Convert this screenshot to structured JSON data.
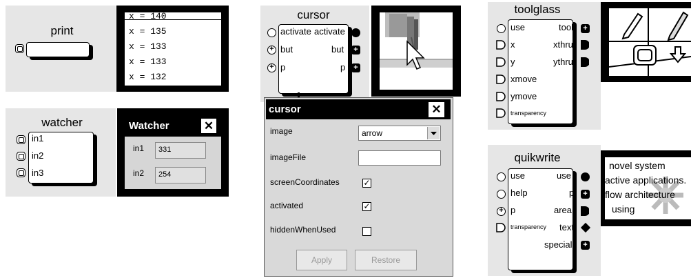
{
  "print": {
    "title": "print",
    "log_lines": [
      "x = 140",
      "x = 135",
      "x = 133",
      "x = 133",
      "x = 132"
    ]
  },
  "watcher": {
    "title": "watcher",
    "inputs": [
      "in1",
      "in2",
      "in3"
    ],
    "window": {
      "title": "Watcher",
      "close": "✕",
      "rows": [
        {
          "label": "in1",
          "value": "331"
        },
        {
          "label": "in2",
          "value": "254"
        }
      ]
    }
  },
  "cursor": {
    "title": "cursor",
    "ports": [
      {
        "in": "activate",
        "out": "activate"
      },
      {
        "in": "but",
        "out": "but"
      },
      {
        "in": "p",
        "out": "p"
      }
    ],
    "dialog": {
      "title": "cursor",
      "close": "✕",
      "image_label": "image",
      "image_value": "arrow",
      "imagefile_label": "imageFile",
      "imagefile_value": "",
      "checks": [
        {
          "label": "screenCoordinates",
          "checked": true,
          "mark": "✓"
        },
        {
          "label": "activated",
          "checked": true,
          "mark": "✓"
        },
        {
          "label": "hiddenWhenUsed",
          "checked": false,
          "mark": ""
        }
      ],
      "apply": "Apply",
      "restore": "Restore"
    }
  },
  "toolglass": {
    "title": "toolglass",
    "inputs": [
      "use",
      "x",
      "y",
      "xmove",
      "ymove",
      "transparency"
    ],
    "outputs": [
      "tool",
      "xthru",
      "ythru"
    ]
  },
  "quikwrite": {
    "title": "quikwrite",
    "inputs": [
      "use",
      "help",
      "p",
      "transparency"
    ],
    "outputs": [
      "use",
      "p",
      "area",
      "text",
      "special"
    ],
    "sample_text": [
      "novel system",
      "active applications.",
      "flow architecture",
      "using"
    ]
  }
}
